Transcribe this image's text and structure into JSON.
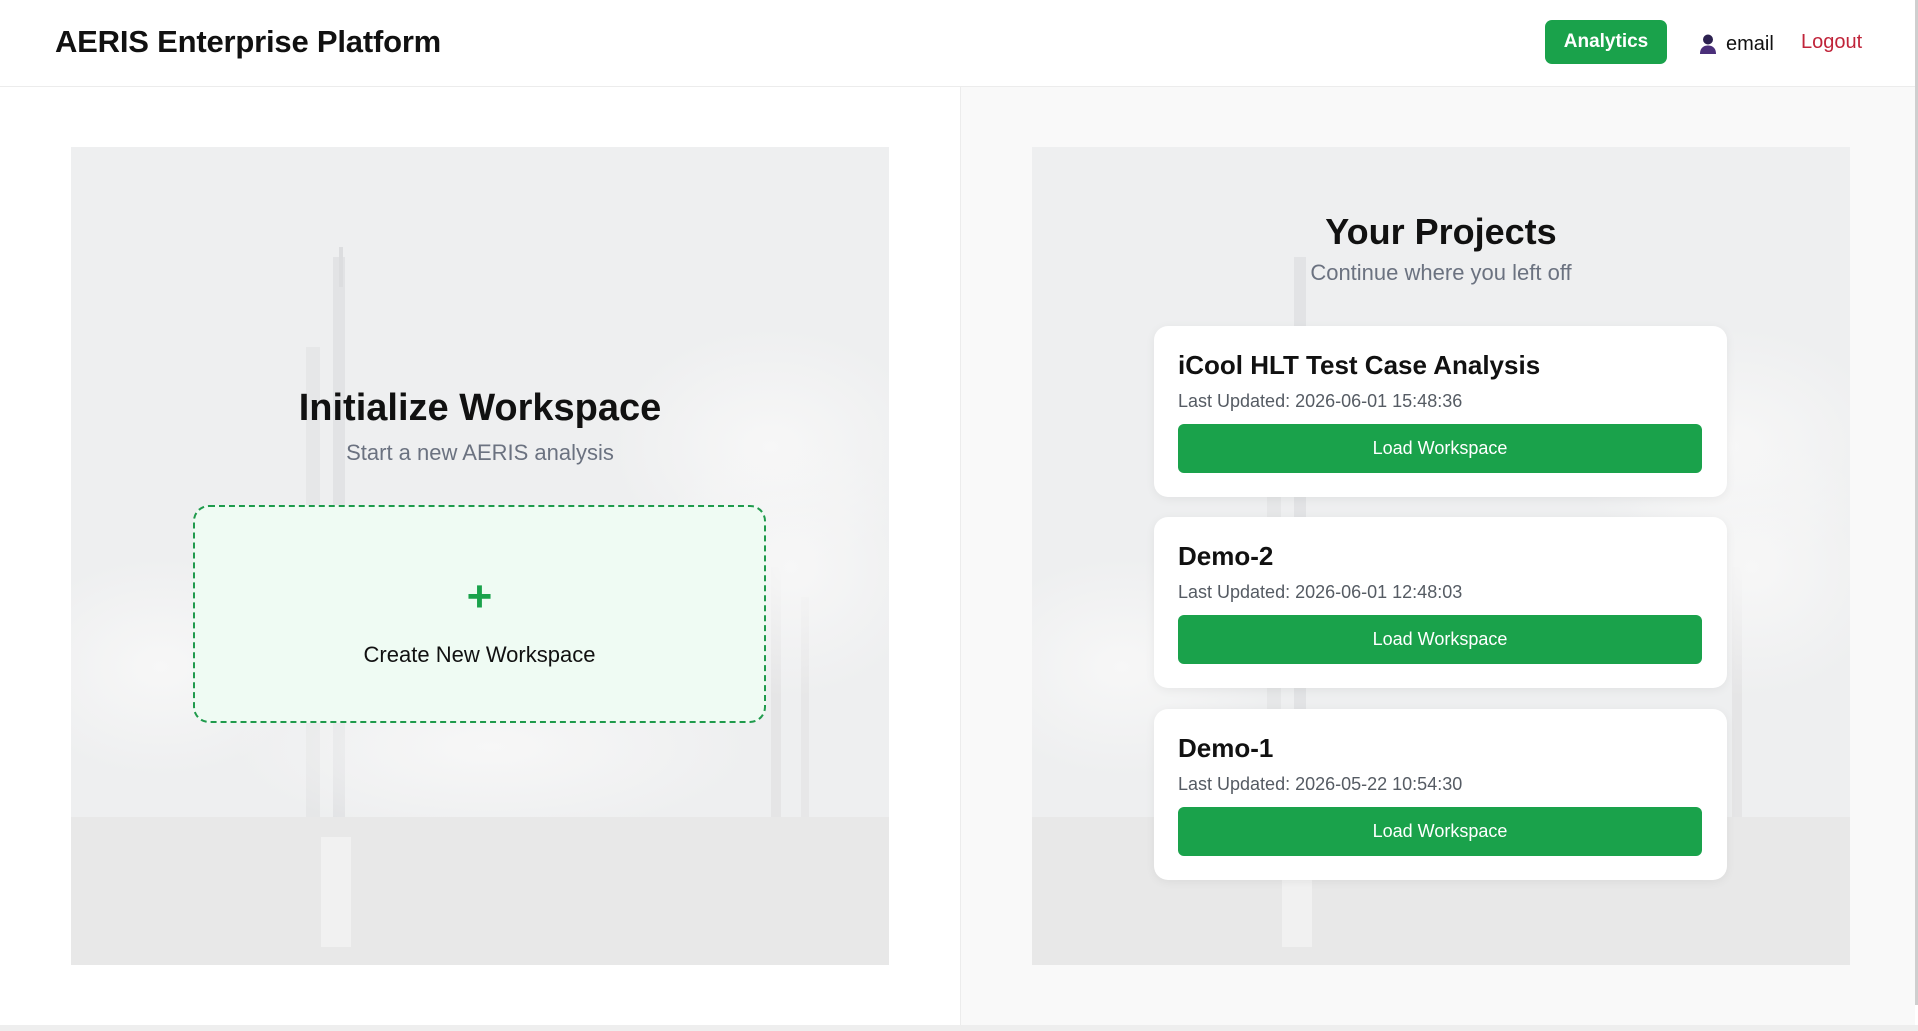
{
  "header": {
    "brand": "AERIS Enterprise Platform",
    "analytics_label": "Analytics",
    "user_label": "email",
    "user_icon": "user-icon",
    "logout_label": "Logout"
  },
  "workspace": {
    "title": "Initialize Workspace",
    "subtitle": "Start a new AERIS analysis",
    "create_icon": "plus-icon",
    "create_symbol": "+",
    "create_label": "Create New Workspace"
  },
  "projects": {
    "title": "Your Projects",
    "subtitle": "Continue where you left off",
    "items": [
      {
        "name": "iCool HLT Test Case Analysis",
        "updated": "Last Updated: 2026-06-01 15:48:36",
        "button": "Load Workspace"
      },
      {
        "name": "Demo-2",
        "updated": "Last Updated: 2026-06-01 12:48:03",
        "button": "Load Workspace"
      },
      {
        "name": "Demo-1",
        "updated": "Last Updated: 2026-05-22 10:54:30",
        "button": "Load Workspace"
      }
    ]
  },
  "colors": {
    "accent_green": "#1aa24b",
    "logout_red": "#c0243a",
    "muted_text": "#6b7280",
    "create_card_bg": "#effbf3"
  }
}
